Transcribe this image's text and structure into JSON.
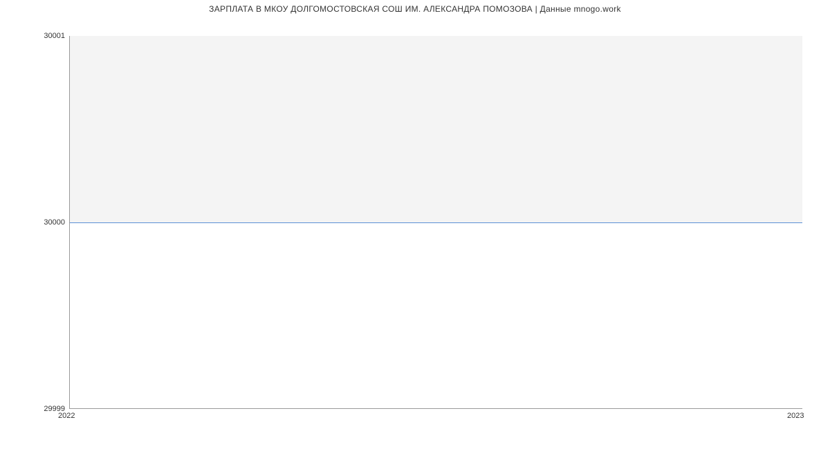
{
  "chart_data": {
    "type": "line",
    "title": "ЗАРПЛАТА В МКОУ ДОЛГОМОСТОВСКАЯ СОШ ИМ. АЛЕКСАНДРА ПОМОЗОВА | Данные mnogo.work",
    "x": [
      2022,
      2023
    ],
    "values": [
      30000,
      30000
    ],
    "xlabel": "",
    "ylabel": "",
    "ylim": [
      29999,
      30001
    ],
    "y_ticks": [
      29999,
      30000,
      30001
    ],
    "x_ticks": [
      2022,
      2023
    ],
    "line_color": "#5b8fd6"
  },
  "labels": {
    "y_top": "30001",
    "y_mid": "30000",
    "y_bot": "29999",
    "x_left": "2022",
    "x_right": "2023"
  }
}
